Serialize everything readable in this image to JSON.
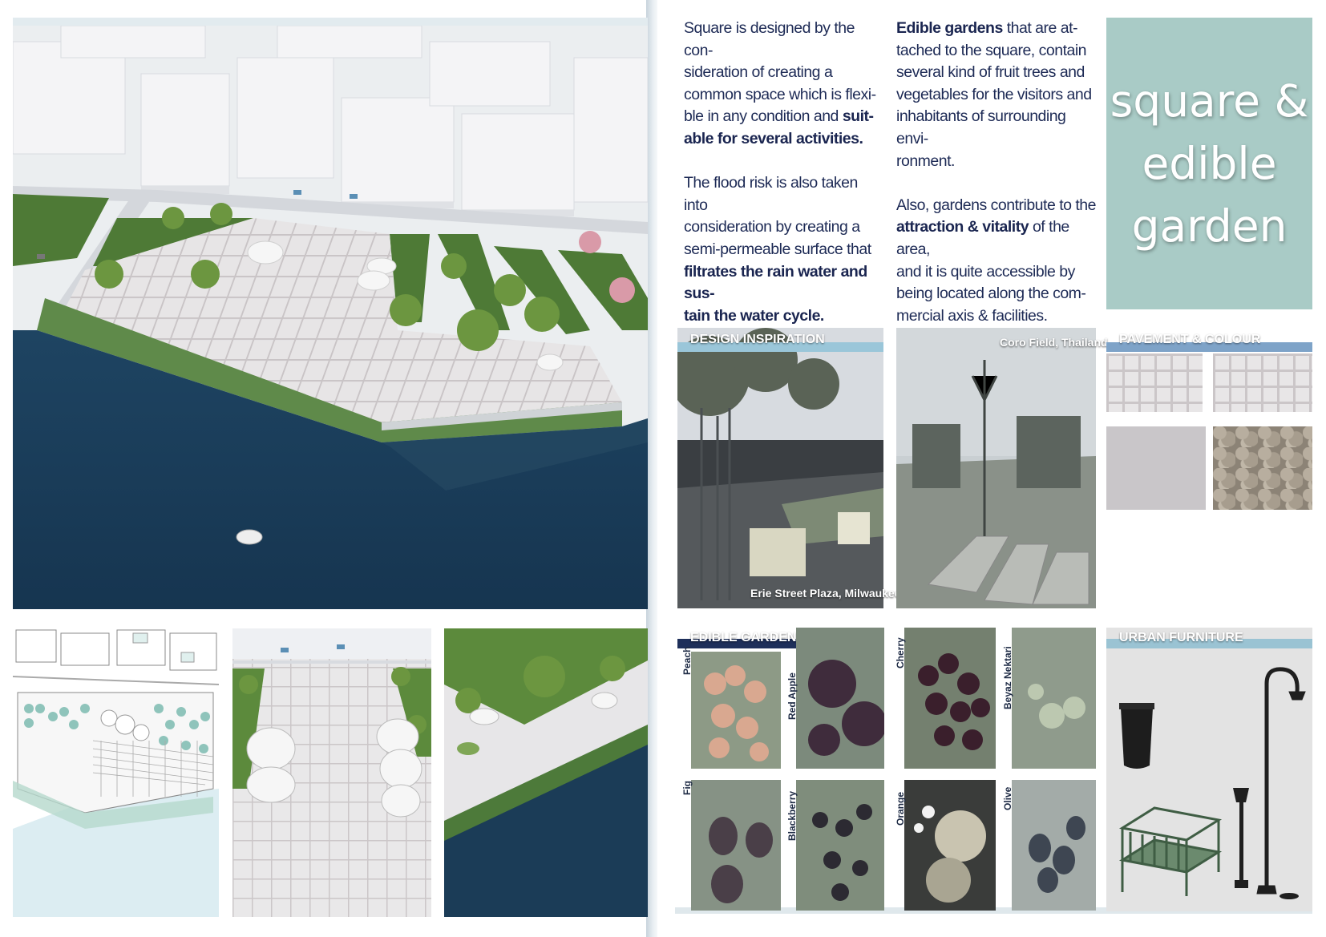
{
  "paragraphs": {
    "left": {
      "p1_a": "Square is designed by the con-",
      "p1_b": "sideration of creating a",
      "p1_c": "common space which is flexi-",
      "p1_d1": "ble in any condition and ",
      "p1_d2": "suit-",
      "p1_e": "able for several activities.",
      "p2_a": "The flood risk is also taken into",
      "p2_b": "consideration by creating a",
      "p2_c": "semi-permeable surface that",
      "p2_d": "filtrates the rain water and sus-",
      "p2_e": "tain the water cycle."
    },
    "right": {
      "p1_a1": "Edible gardens",
      "p1_a2": " that are at-",
      "p1_b": "tached to the square, contain",
      "p1_c": "several kind of fruit trees and",
      "p1_d": "vegetables for the visitors and",
      "p1_e": "inhabitants of surrounding envi-",
      "p1_f": "ronment.",
      "p2_a": "Also, gardens contribute to the",
      "p2_b1": "attraction & vitality",
      "p2_b2": " of the area,",
      "p2_c": "and it is quite accessible by",
      "p2_d": "being located along the com-",
      "p2_e": "mercial axis & facilities."
    }
  },
  "title": {
    "line1": "square &",
    "line2": "edible",
    "line3": "garden"
  },
  "sections": {
    "design_inspiration": "DESIGN INSPIRATION",
    "pavement": "PAVEMENT & COLOUR",
    "edible_garden": "EDIBLE GARDEN",
    "urban_furniture": "URBAN FURNITURE"
  },
  "captions": {
    "erie": "Erie Street Plaza, Milwaukee",
    "coro": "Coro Field, Thailand"
  },
  "fruits": [
    "Peach",
    "Red Apple",
    "Cherry",
    "Beyaz Nektari",
    "Fig",
    "Blackberry",
    "Orange",
    "Olive"
  ],
  "colors": {
    "title_bg": "#a9cbc6",
    "text_dark": "#1d2a55",
    "light_bar": "#9ac6d9",
    "navy_bar": "#1e2f5a",
    "water": "#1a3a58"
  }
}
